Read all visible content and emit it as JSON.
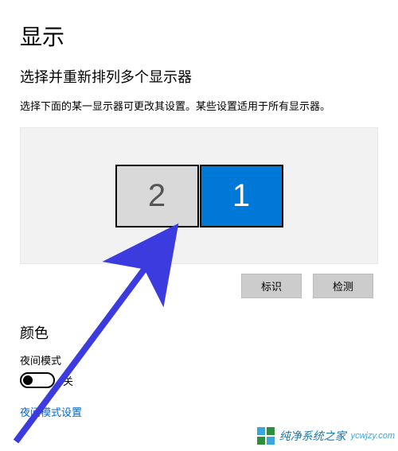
{
  "title": "显示",
  "subtitle": "选择并重新排列多个显示器",
  "helptext": "选择下面的某一显示器可更改其设置。某些设置适用于所有显示器。",
  "monitors": {
    "m1": "1",
    "m2": "2"
  },
  "buttons": {
    "identify": "标识",
    "detect": "检测"
  },
  "color": {
    "heading": "颜色",
    "night_mode_label": "夜间模式",
    "off_text": "关",
    "settings_link": "夜间模式设置"
  },
  "watermark": {
    "brand": "纯净系统之家",
    "url": "ycwjzy.com"
  }
}
